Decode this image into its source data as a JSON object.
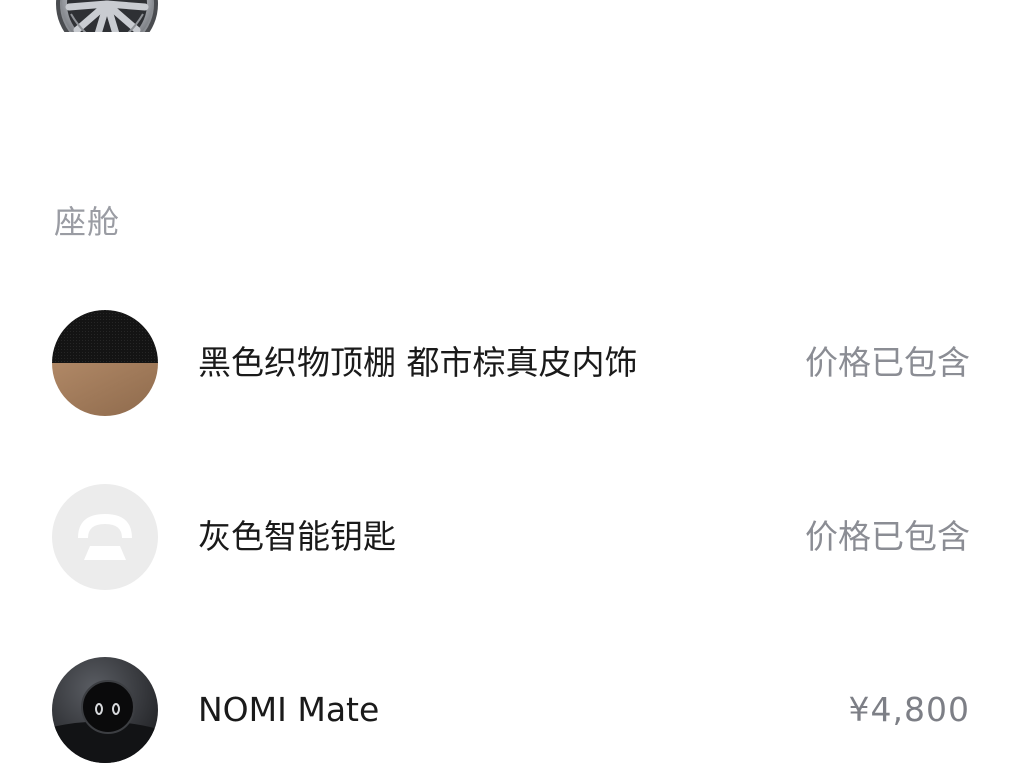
{
  "wheel_icon": "wheel-rim-icon",
  "section": {
    "title": "座舱"
  },
  "options": [
    {
      "name": "黑色织物顶棚 都市棕真皮内饰",
      "price": "价格已包含",
      "icon": "interior-swatch-icon",
      "colors": [
        "#151515",
        "#a07a5a"
      ]
    },
    {
      "name": "灰色智能钥匙",
      "price": "价格已包含",
      "icon": "nio-logo-key-icon",
      "colors": [
        "#ededed",
        "#ffffff"
      ]
    },
    {
      "name": "NOMI Mate",
      "price": "¥4,800",
      "icon": "nomi-mate-icon",
      "colors": [
        "#2b2d31",
        "#0c0c0e"
      ]
    }
  ]
}
